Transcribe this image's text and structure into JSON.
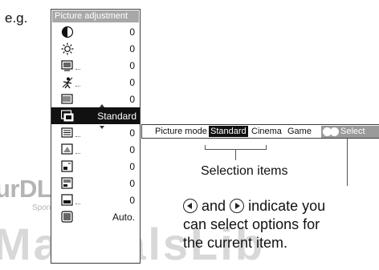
{
  "example_label": "e.g.",
  "menu": {
    "title": "Picture adjustment",
    "rows": [
      {
        "icon": "contrast-icon",
        "value": "0"
      },
      {
        "icon": "brightness-icon",
        "value": "0"
      },
      {
        "icon": "color-icon",
        "value": "0"
      },
      {
        "icon": "tint-icon",
        "value": "0"
      },
      {
        "icon": "sharpness-icon",
        "value": "0"
      },
      {
        "icon": "picture-mode-icon",
        "value": "Standard",
        "highlighted": true
      },
      {
        "icon": "color-temp-icon",
        "value": "0"
      },
      {
        "icon": "noise-reduction-icon",
        "value": "0"
      },
      {
        "icon": "gamma-icon",
        "value": "0"
      },
      {
        "icon": "black-level-icon",
        "value": "0"
      },
      {
        "icon": "white-level-icon",
        "value": "0"
      },
      {
        "icon": "auto-setup-icon",
        "value": "Auto."
      }
    ]
  },
  "submenu": {
    "label": "Picture mode",
    "options": [
      "Standard",
      "Cinema",
      "Game"
    ],
    "selected": "Standard",
    "select_button": "Select"
  },
  "annotations": {
    "selection_items": "Selection items",
    "desc_part1": "and",
    "desc_part2": "indicate you",
    "desc_line2": "can select options for",
    "desc_line3": "the current item."
  },
  "watermark": {
    "site": "urDLL.com",
    "sponsored": "Sponsored by",
    "brand": "ManualsLib"
  }
}
